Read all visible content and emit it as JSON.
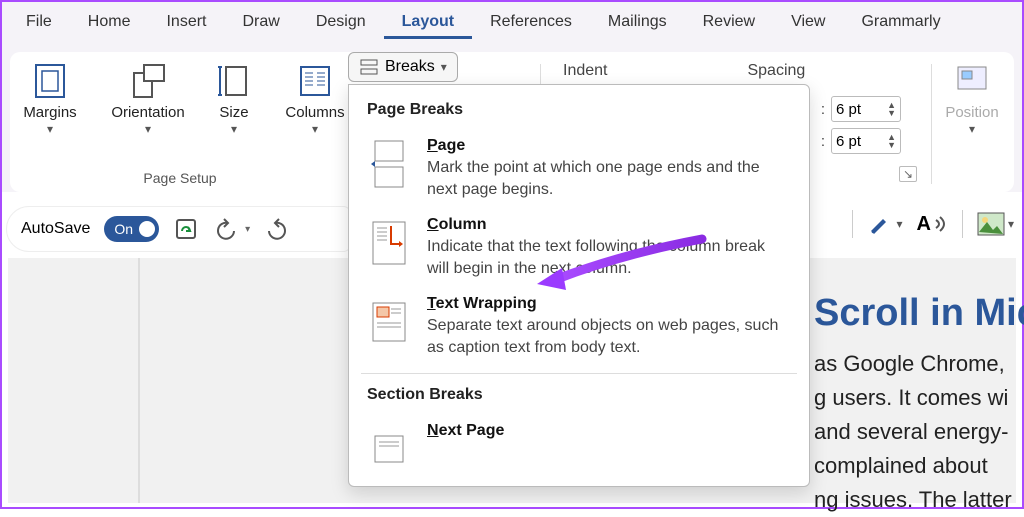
{
  "tabs": [
    "File",
    "Home",
    "Insert",
    "Draw",
    "Design",
    "Layout",
    "References",
    "Mailings",
    "Review",
    "View",
    "Grammarly"
  ],
  "active_tab": "Layout",
  "page_setup": {
    "margins": "Margins",
    "orientation": "Orientation",
    "size": "Size",
    "columns": "Columns",
    "caption": "Page Setup"
  },
  "breaks_button": "Breaks",
  "paragraph": {
    "indent_label": "Indent",
    "spacing_label": "Spacing",
    "before_value": "6 pt",
    "after_value": "6 pt"
  },
  "arrange": {
    "position": "Position"
  },
  "breaks_menu": {
    "heading1": "Page Breaks",
    "items1": [
      {
        "title": "Page",
        "underline_char": "P",
        "desc": "Mark the point at which one page ends and the next page begins."
      },
      {
        "title": "Column",
        "underline_char": "C",
        "desc": "Indicate that the text following the column break will begin in the next column."
      },
      {
        "title": "Text Wrapping",
        "underline_char": "T",
        "desc": "Separate text around objects on web pages, such as caption text from body text."
      }
    ],
    "heading2": "Section Breaks",
    "items2": [
      {
        "title": "Next Page",
        "underline_char": "N",
        "desc": ""
      }
    ]
  },
  "qat": {
    "autosave": "AutoSave",
    "toggle": "On"
  },
  "document": {
    "title_fragment": "Scroll in Mic",
    "body_lines": [
      "as Google Chrome,",
      "g users. It comes wi",
      "and several energy-",
      "complained about ",
      "ng issues. The latter"
    ]
  }
}
